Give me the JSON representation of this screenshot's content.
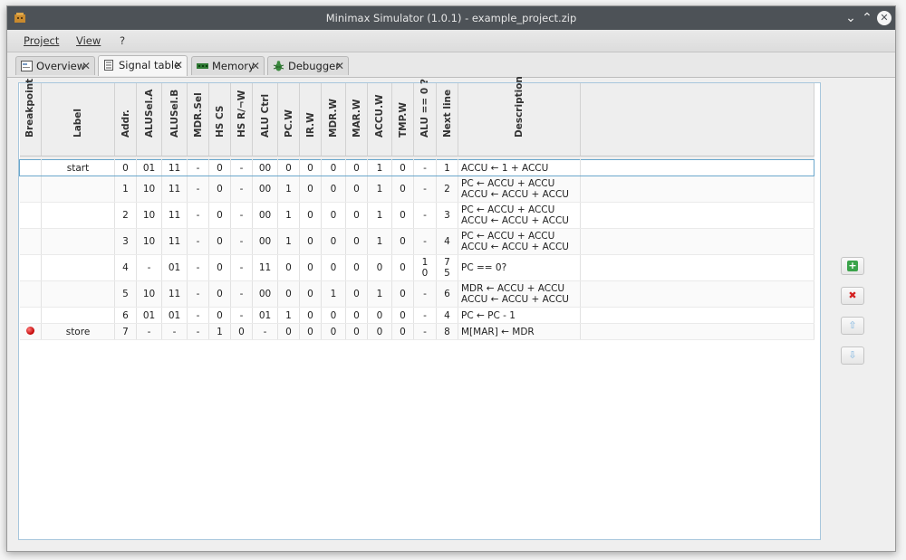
{
  "window": {
    "title": "Minimax Simulator (1.0.1) - example_project.zip"
  },
  "titlebar": {
    "minimize": "⌄",
    "maximize": "⌃",
    "close": "✕"
  },
  "menu": [
    "Project",
    "View",
    "?"
  ],
  "tabs": [
    {
      "label": "Overview",
      "icon": "overview-icon",
      "active": false
    },
    {
      "label": "Signal table",
      "icon": "signal-table-icon",
      "active": true
    },
    {
      "label": "Memory",
      "icon": "memory-icon",
      "active": false
    },
    {
      "label": "Debugger",
      "icon": "bug-icon",
      "active": false
    }
  ],
  "tab_close": "✕",
  "columns": [
    "Breakpoint",
    "Label",
    "Addr.",
    "ALUSel.A",
    "ALUSel.B",
    "MDR.Sel",
    "HS CS",
    "HS R/¬W",
    "ALU Ctrl",
    "PC.W",
    "IR.W",
    "MDR.W",
    "MAR.W",
    "ACCU.W",
    "TMP.W",
    "ALU == 0 ?",
    "Next line",
    "Description"
  ],
  "rows": [
    {
      "breakpoint": false,
      "label": "start",
      "addr": "0",
      "alusel_a": "01",
      "alusel_b": "11",
      "mdr_sel": "-",
      "hs_cs": "0",
      "hs_rw": "-",
      "alu_ctrl": "00",
      "pc_w": "0",
      "ir_w": "0",
      "mdr_w": "0",
      "mar_w": "0",
      "accu_w": "1",
      "tmp_w": "0",
      "alu_zero": "-",
      "next_line": "1",
      "desc": [
        "ACCU ← 1 + ACCU"
      ]
    },
    {
      "breakpoint": false,
      "label": "",
      "addr": "1",
      "alusel_a": "10",
      "alusel_b": "11",
      "mdr_sel": "-",
      "hs_cs": "0",
      "hs_rw": "-",
      "alu_ctrl": "00",
      "pc_w": "1",
      "ir_w": "0",
      "mdr_w": "0",
      "mar_w": "0",
      "accu_w": "1",
      "tmp_w": "0",
      "alu_zero": "-",
      "next_line": "2",
      "desc": [
        "PC ← ACCU + ACCU",
        "ACCU ← ACCU + ACCU"
      ]
    },
    {
      "breakpoint": false,
      "label": "",
      "addr": "2",
      "alusel_a": "10",
      "alusel_b": "11",
      "mdr_sel": "-",
      "hs_cs": "0",
      "hs_rw": "-",
      "alu_ctrl": "00",
      "pc_w": "1",
      "ir_w": "0",
      "mdr_w": "0",
      "mar_w": "0",
      "accu_w": "1",
      "tmp_w": "0",
      "alu_zero": "-",
      "next_line": "3",
      "desc": [
        "PC ← ACCU + ACCU",
        "ACCU ← ACCU + ACCU"
      ]
    },
    {
      "breakpoint": false,
      "label": "",
      "addr": "3",
      "alusel_a": "10",
      "alusel_b": "11",
      "mdr_sel": "-",
      "hs_cs": "0",
      "hs_rw": "-",
      "alu_ctrl": "00",
      "pc_w": "1",
      "ir_w": "0",
      "mdr_w": "0",
      "mar_w": "0",
      "accu_w": "1",
      "tmp_w": "0",
      "alu_zero": "-",
      "next_line": "4",
      "desc": [
        "PC ← ACCU + ACCU",
        "ACCU ← ACCU + ACCU"
      ]
    },
    {
      "breakpoint": false,
      "label": "",
      "addr": "4",
      "alusel_a": "-",
      "alusel_b": "01",
      "mdr_sel": "-",
      "hs_cs": "0",
      "hs_rw": "-",
      "alu_ctrl": "11",
      "pc_w": "0",
      "ir_w": "0",
      "mdr_w": "0",
      "mar_w": "0",
      "accu_w": "0",
      "tmp_w": "0",
      "alu_zero": "1\n0",
      "next_line": "7\n5",
      "desc": [
        "PC == 0?",
        ""
      ]
    },
    {
      "breakpoint": false,
      "label": "",
      "addr": "5",
      "alusel_a": "10",
      "alusel_b": "11",
      "mdr_sel": "-",
      "hs_cs": "0",
      "hs_rw": "-",
      "alu_ctrl": "00",
      "pc_w": "0",
      "ir_w": "0",
      "mdr_w": "1",
      "mar_w": "0",
      "accu_w": "1",
      "tmp_w": "0",
      "alu_zero": "-",
      "next_line": "6",
      "desc": [
        "MDR ← ACCU + ACCU",
        "ACCU ← ACCU + ACCU"
      ]
    },
    {
      "breakpoint": false,
      "label": "",
      "addr": "6",
      "alusel_a": "01",
      "alusel_b": "01",
      "mdr_sel": "-",
      "hs_cs": "0",
      "hs_rw": "-",
      "alu_ctrl": "01",
      "pc_w": "1",
      "ir_w": "0",
      "mdr_w": "0",
      "mar_w": "0",
      "accu_w": "0",
      "tmp_w": "0",
      "alu_zero": "-",
      "next_line": "4",
      "desc": [
        "PC ← PC - 1"
      ]
    },
    {
      "breakpoint": true,
      "label": "store",
      "addr": "7",
      "alusel_a": "-",
      "alusel_b": "-",
      "mdr_sel": "-",
      "hs_cs": "1",
      "hs_rw": "0",
      "alu_ctrl": "-",
      "pc_w": "0",
      "ir_w": "0",
      "mdr_w": "0",
      "mar_w": "0",
      "accu_w": "0",
      "tmp_w": "0",
      "alu_zero": "-",
      "next_line": "8",
      "desc": [
        "M[MAR] ← MDR"
      ]
    }
  ],
  "side_buttons": [
    {
      "name": "add-row-button",
      "icon": "plus-icon",
      "color": "#3aa34a",
      "glyph": "+"
    },
    {
      "name": "delete-row-button",
      "icon": "delete-icon",
      "color": "#d42020",
      "glyph": "✖"
    },
    {
      "name": "move-up-button",
      "icon": "arrow-up-icon",
      "color": "#9cc4e4",
      "glyph": "⇧"
    },
    {
      "name": "move-down-button",
      "icon": "arrow-down-icon",
      "color": "#9cc4e4",
      "glyph": "⇩"
    }
  ],
  "colors": {
    "titlebar": "#4d5257",
    "selection_border": "#6aa7cc",
    "breakpoint": "#c00000"
  }
}
